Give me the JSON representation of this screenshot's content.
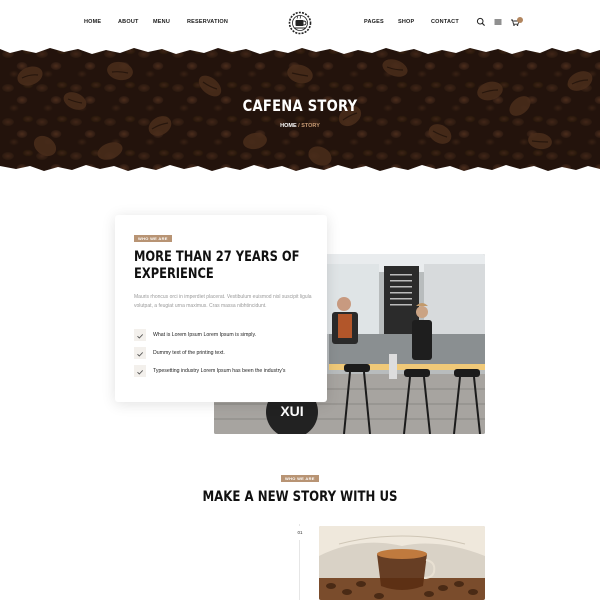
{
  "nav": {
    "left_links": [
      "HOME",
      "ABOUT",
      "MENU",
      "RESERVATION"
    ],
    "right_links": [
      "PAGES",
      "SHOP",
      "CONTACT"
    ],
    "logo_icon": "coffee-cup-logo-icon",
    "icons": [
      "search-icon",
      "menu-icon",
      "cart-icon"
    ]
  },
  "hero": {
    "title": "CAFENA STORY",
    "breadcrumb_home": "HOME",
    "breadcrumb_sep": "/",
    "breadcrumb_current": "STORY"
  },
  "about": {
    "tag": "WHO WE ARE",
    "title_line1": "MORE THAN 27 YEARS OF",
    "title_line2": "EXPERIENCE",
    "description": "Mauris rhoncus orci in imperdiet placerat. Vestibulum euismod nisl suscipit ligula volutpat, a feugiat urna maximus. Cras massa nibhtincidunt.",
    "checklist": [
      "What is Lorem Ipsum Lorem Ipsum is simply.",
      "Dummy text of the printing text.",
      "Typesetting industry Lorem Ipsum has been the industry's"
    ]
  },
  "story": {
    "tag": "WHO WE ARE",
    "title": "MAKE A NEW STORY WITH US",
    "step_number": "01"
  },
  "colors": {
    "accent": "#b89474",
    "hero_dark": "#2b1a10",
    "text": "#111111"
  }
}
